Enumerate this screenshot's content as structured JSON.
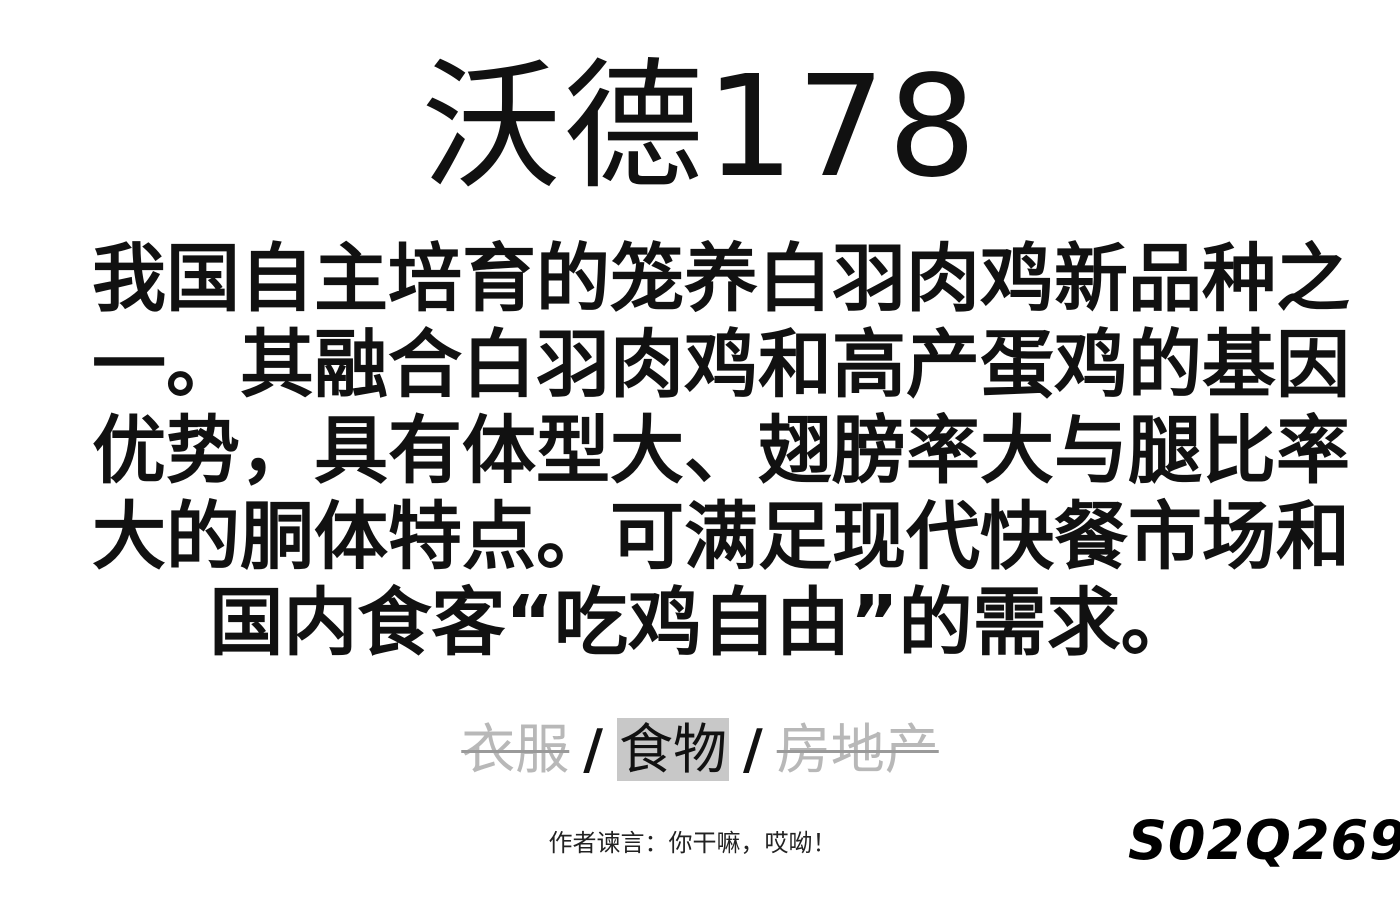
{
  "title": "沃德178",
  "description_lines": [
    "我国自主培育的笼养白羽肉鸡新品种之",
    "一。其融合白羽肉鸡和高产蛋鸡的基因",
    "优势，具有体型大、翅膀率大与腿比率",
    "大的胴体特点。可满足现代快餐市场和",
    "国内食客“吃鸡自由”的需求。"
  ],
  "categories": [
    {
      "label": "衣服",
      "state": "struck"
    },
    {
      "label": "食物",
      "state": "selected"
    },
    {
      "label": "房地产",
      "state": "struck"
    }
  ],
  "separator": "/",
  "author_note": "作者谏言：你干嘛，哎呦！",
  "code": "S02Q269",
  "colors": {
    "text": "#111111",
    "struck_text": "#b8b8b8",
    "selected_bg": "#c8c8c8"
  }
}
